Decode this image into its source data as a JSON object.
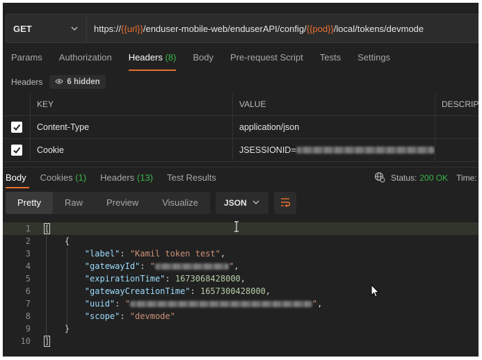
{
  "request": {
    "method": "GET",
    "url_parts": [
      {
        "text": "https://",
        "var": false
      },
      {
        "text": "{{url}}",
        "var": true
      },
      {
        "text": "/enduser-mobile-web/enduserAPI/config/",
        "var": false
      },
      {
        "text": "{{pod}}",
        "var": true
      },
      {
        "text": "/local/tokens/devmode",
        "var": false
      }
    ]
  },
  "request_tabs": {
    "params": "Params",
    "authorization": "Authorization",
    "headers": "Headers",
    "headers_count": "(8)",
    "body": "Body",
    "pre_request": "Pre-request Script",
    "tests": "Tests",
    "settings": "Settings"
  },
  "headers_section": {
    "title": "Headers",
    "hidden": "6 hidden"
  },
  "headers_table": {
    "columns": {
      "key": "KEY",
      "value": "VALUE",
      "description": "DESCRIP"
    },
    "rows": [
      {
        "key": "Content-Type",
        "value": "application/json"
      },
      {
        "key": "Cookie",
        "value": "JSESSIONID="
      }
    ]
  },
  "response_tabs": {
    "body": "Body",
    "cookies": "Cookies",
    "cookies_count": "(1)",
    "headers": "Headers",
    "headers_count": "(13)",
    "test_results": "Test Results"
  },
  "status": {
    "label": "Status:",
    "value": "200 OK",
    "time_label": "Time:"
  },
  "view_modes": {
    "pretty": "Pretty",
    "raw": "Raw",
    "preview": "Preview",
    "visualize": "Visualize"
  },
  "format": "JSON",
  "code": {
    "open_array": "[",
    "open_obj": "{",
    "close_obj": "}",
    "close_array": "]",
    "label_key": "\"label\"",
    "label_val": "\"Kamil token test\"",
    "gateway_key": "\"gatewayId\"",
    "expiration_key": "\"expirationTime\"",
    "expiration_val": "1673068428000",
    "creation_key": "\"gatewayCreationTime\"",
    "creation_val": "1657300428000",
    "uuid_key": "\"uuid\"",
    "scope_key": "\"scope\"",
    "scope_val": "\"devmode\"",
    "line_numbers": [
      "1",
      "2",
      "3",
      "4",
      "5",
      "6",
      "7",
      "8",
      "9",
      "10"
    ]
  },
  "colors": {
    "accent": "#e8712c",
    "success": "#3ab54a",
    "background": "#212121"
  }
}
